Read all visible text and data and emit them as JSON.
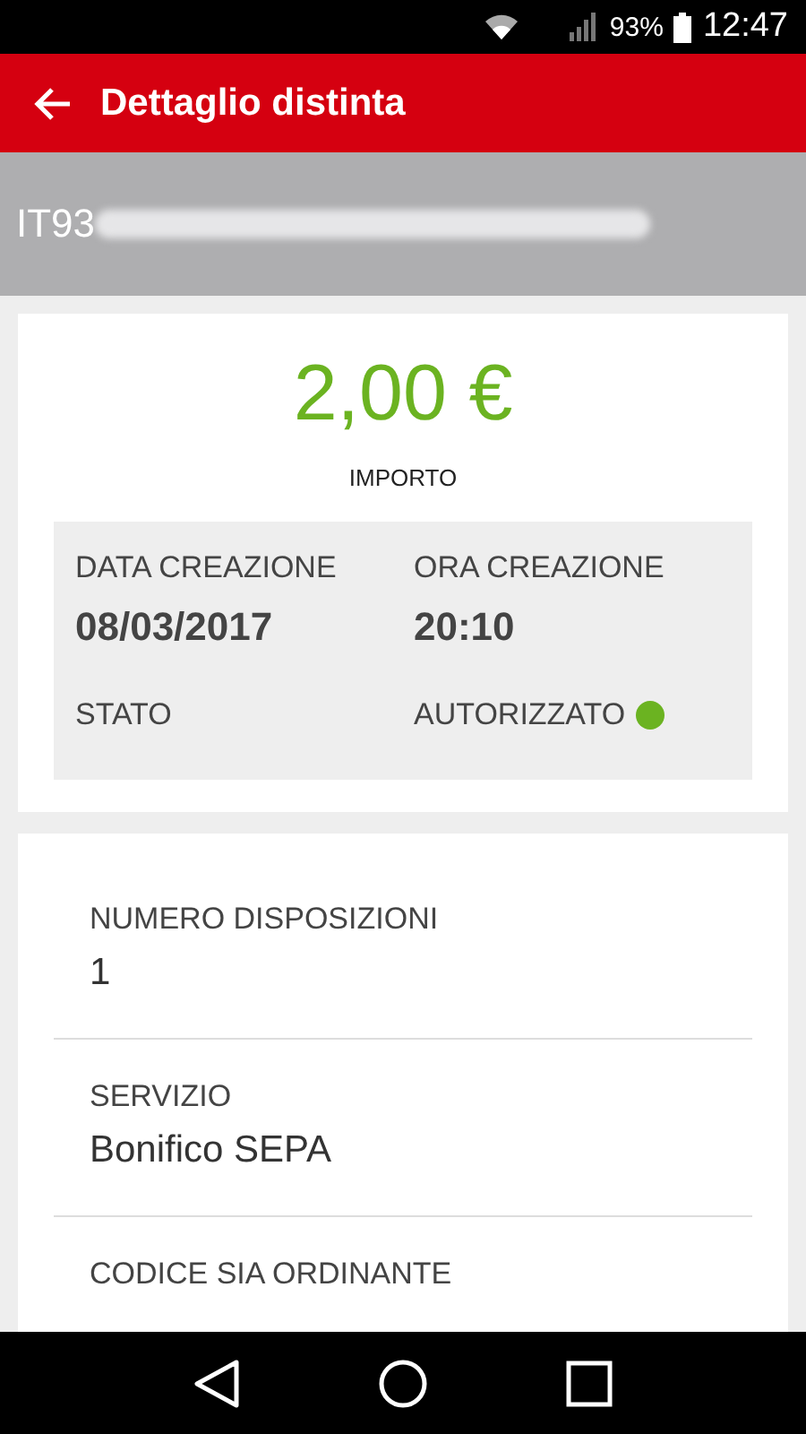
{
  "status_bar": {
    "battery": "93%",
    "time": "12:47"
  },
  "toolbar": {
    "title": "Dettaglio distinta"
  },
  "account": {
    "prefix": "IT93",
    "redacted": true
  },
  "summary": {
    "amount": "2,00 €",
    "amount_label": "IMPORTO",
    "fields": [
      {
        "label": "DATA CREAZIONE",
        "value": "08/03/2017"
      },
      {
        "label": "ORA CREAZIONE",
        "value": "20:10"
      }
    ],
    "status": {
      "label": "STATO",
      "value": "AUTORIZZATO",
      "color": "#6bb321"
    }
  },
  "details": [
    {
      "label": "NUMERO DISPOSIZIONI",
      "value": "1"
    },
    {
      "label": "SERVIZIO",
      "value": "Bonifico SEPA"
    },
    {
      "label": "CODICE SIA ORDINANTE"
    }
  ]
}
